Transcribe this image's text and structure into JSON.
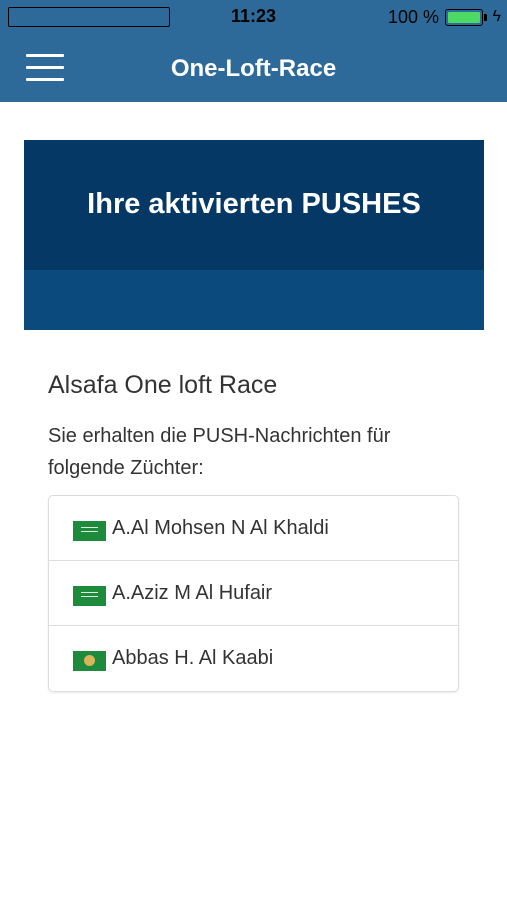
{
  "status_bar": {
    "time": "11:23",
    "battery_percent": "100 %",
    "battery_level": 1.0,
    "battery_color": "#4cd964"
  },
  "nav": {
    "title": "One-Loft-Race",
    "menu_icon": "hamburger-menu-icon",
    "background_color": "#2d6a99"
  },
  "banner": {
    "title": "Ihre aktivierten PUSHES",
    "color_top": "#053865",
    "color_bottom": "#0a4a7c"
  },
  "content": {
    "race_title": "Alsafa One loft Race",
    "intro": "Sie erhalten die PUSH-Nachrichten für folgende Züchter:",
    "breeders": [
      {
        "name": "A.Al Mohsen N Al Khaldi",
        "flag": "saudi-arabia-flag-icon"
      },
      {
        "name": "A.Aziz M Al Hufair",
        "flag": "saudi-arabia-flag-icon"
      },
      {
        "name": "Abbas H. Al Kaabi",
        "flag": "arab-league-flag-icon"
      }
    ]
  }
}
